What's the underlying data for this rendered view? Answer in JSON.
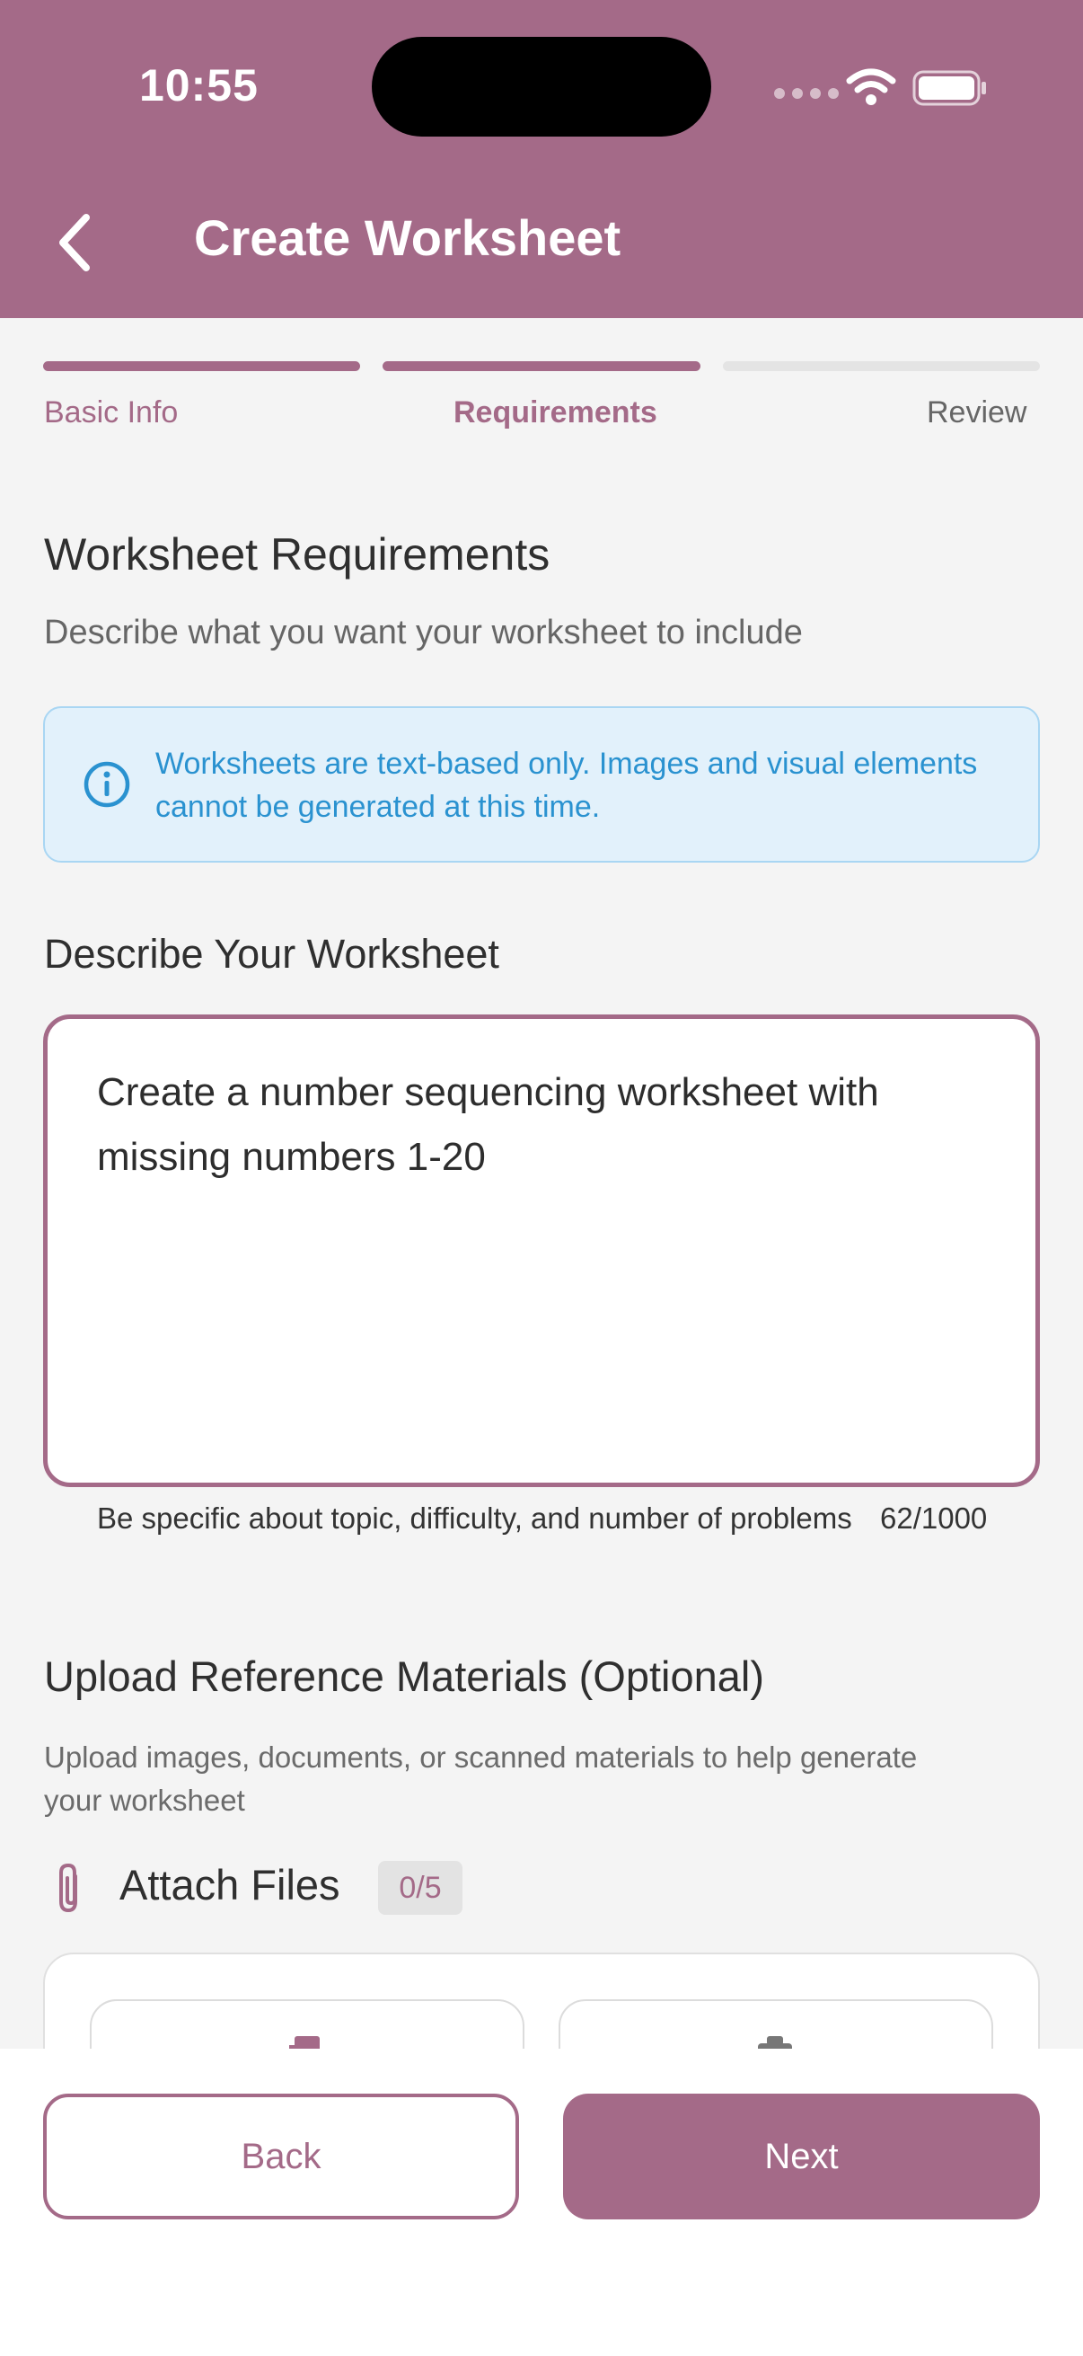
{
  "status_bar": {
    "time": "10:55"
  },
  "header": {
    "title": "Create Worksheet",
    "back_icon": "chevron-left-icon"
  },
  "stepper": {
    "steps": [
      {
        "label": "Basic Info",
        "state": "complete"
      },
      {
        "label": "Requirements",
        "state": "current"
      },
      {
        "label": "Review",
        "state": "upcoming"
      }
    ]
  },
  "requirements": {
    "title": "Worksheet Requirements",
    "subtitle": "Describe what you want your worksheet to include"
  },
  "info_notice": {
    "icon": "info-icon",
    "text": "Worksheets are text-based only. Images and visual elements cannot be generated at this time."
  },
  "describe": {
    "label": "Describe Your Worksheet",
    "value": "Create a number sequencing worksheet with missing numbers 1-20",
    "helper": "Be specific about topic, difficulty, and number of problems",
    "counter": "62/1000"
  },
  "upload": {
    "title": "Upload Reference Materials (Optional)",
    "subtitle": "Upload images, documents, or scanned materials to help generate your worksheet",
    "attach_label": "Attach Files",
    "attach_count": "0/5",
    "icons": [
      "paperclip-icon",
      "file-icon",
      "camera-icon"
    ]
  },
  "footer": {
    "back_label": "Back",
    "next_label": "Next"
  },
  "colors": {
    "accent": "#a46a88",
    "info_background": "#e2f1fb",
    "info_text": "#2a92d0",
    "page_background": "#f4f4f4"
  }
}
